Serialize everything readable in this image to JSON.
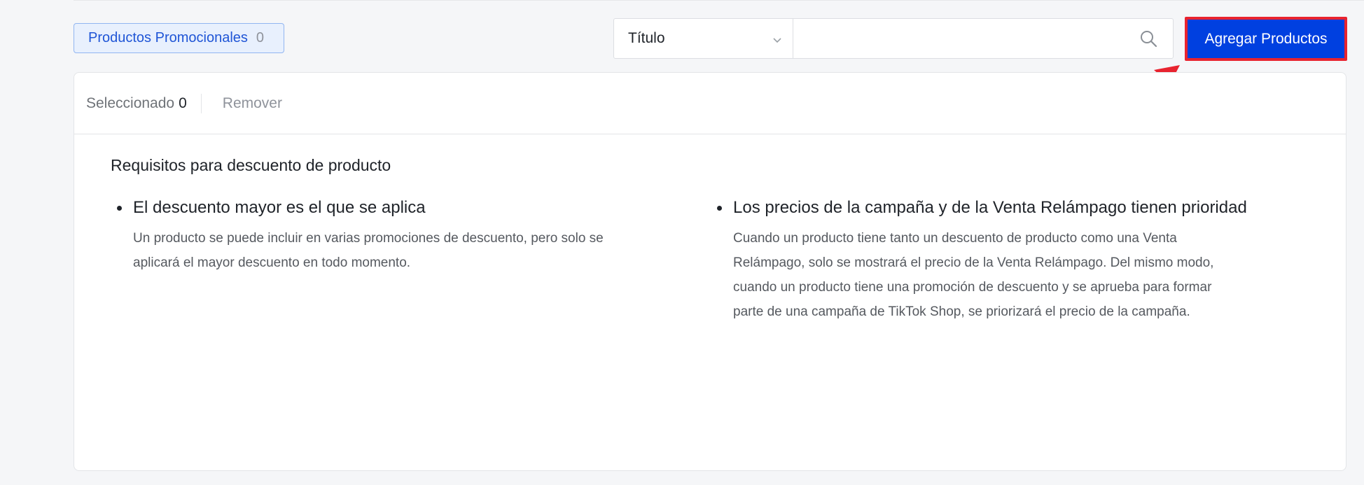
{
  "tag": {
    "label": "Productos Promocionales",
    "count": "0"
  },
  "search": {
    "select_value": "Título",
    "input_value": "",
    "placeholder": ""
  },
  "add_button": {
    "label": "Agregar Productos"
  },
  "toolbar": {
    "selected_label": "Seleccionado",
    "selected_count": "0",
    "remove_label": "Remover"
  },
  "requirements": {
    "title": "Requisitos para descuento de producto",
    "items": [
      {
        "heading": "El descuento mayor es el que se aplica",
        "body": "Un producto se puede incluir en varias promociones de descuento, pero solo se aplicará el mayor descuento en todo momento."
      },
      {
        "heading": "Los precios de la campaña y de la Venta Relámpago tienen prioridad",
        "body": "Cuando un producto tiene tanto un descuento de producto como una Venta Relámpago, solo se mostrará el precio de la Venta Relámpago. Del mismo modo, cuando un producto tiene una promoción de descuento y se aprueba para formar parte de una campaña de TikTok Shop, se priorizará el precio de la campaña."
      }
    ]
  },
  "icons": {
    "select_chevron": "chevron-down-icon",
    "search": "search-icon",
    "annotation": "red-arrow-annotation"
  },
  "colors": {
    "primary": "#0040e0",
    "highlight": "#e8232f",
    "tag_text": "#1f55d6"
  }
}
